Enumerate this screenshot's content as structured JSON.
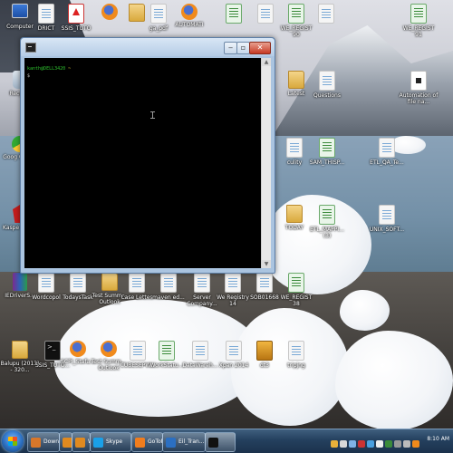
{
  "desktop": {
    "icons": [
      {
        "label": "Computer",
        "kind": "computer"
      },
      {
        "label": "Recycle",
        "kind": "recycle"
      },
      {
        "label": "Goog Chrom",
        "kind": "chrome"
      },
      {
        "label": "Kaspe Anti-V",
        "kind": "kaspersky"
      },
      {
        "label": "DRICT",
        "kind": "doc"
      },
      {
        "label": "SSIS_TUTO",
        "kind": "pdf"
      },
      {
        "label": "",
        "kind": "firefox"
      },
      {
        "label": "",
        "kind": "folder"
      },
      {
        "label": "ga_pdf",
        "kind": "doc"
      },
      {
        "label": "AUTOMATI",
        "kind": "firefox"
      },
      {
        "label": "",
        "kind": "xls"
      },
      {
        "label": "",
        "kind": "doc"
      },
      {
        "label": "WE_REGIST 90",
        "kind": "xls"
      },
      {
        "label": "",
        "kind": "doc"
      },
      {
        "label": "WE_REGIST 91",
        "kind": "xls"
      },
      {
        "label": "Latest",
        "kind": "folder"
      },
      {
        "label": "Questions",
        "kind": "doc"
      },
      {
        "label": "Automation of file na...",
        "kind": "auto"
      },
      {
        "label": "culity",
        "kind": "doc"
      },
      {
        "label": "SAM_THISP...",
        "kind": "xls"
      },
      {
        "label": "ETL_QA_Te...",
        "kind": "doc"
      },
      {
        "label": "TODAY",
        "kind": "folder"
      },
      {
        "label": "ETL_MAPPI... (3)",
        "kind": "xls"
      },
      {
        "label": "UNIX_SOFT...",
        "kind": "doc"
      },
      {
        "label": "IEDriverS...",
        "kind": "winrar"
      },
      {
        "label": "Wordcopol",
        "kind": "doc"
      },
      {
        "label": "TodaysTask",
        "kind": "doc"
      },
      {
        "label": "Test Summ... Outlook",
        "kind": "folder"
      },
      {
        "label": "Case Lettes",
        "kind": "doc"
      },
      {
        "label": "maven ed...",
        "kind": "doc"
      },
      {
        "label": "Server Company...",
        "kind": "doc"
      },
      {
        "label": "We Registry 14",
        "kind": "doc"
      },
      {
        "label": "SOB01668",
        "kind": "doc"
      },
      {
        "label": "WE_REGIST 38",
        "kind": "xls"
      },
      {
        "label": "Balupu (2013) - 320...",
        "kind": "folder"
      },
      {
        "label": "SSIS_TUTO...",
        "kind": "cmd"
      },
      {
        "label": "SCPI_Stafa...",
        "kind": "firefox"
      },
      {
        "label": "Test Summ... Outlook",
        "kind": "firefox"
      },
      {
        "label": "CUBESEPW...",
        "kind": "doc"
      },
      {
        "label": "WorkStatu...",
        "kind": "xls"
      },
      {
        "label": "DataWareh...",
        "kind": "doc"
      },
      {
        "label": "Xpan 2014",
        "kind": "doc"
      },
      {
        "label": "dt3",
        "kind": "gold"
      },
      {
        "label": "tripjng",
        "kind": "doc"
      }
    ]
  },
  "terminal": {
    "prompt_user": "kanth@DELL3420",
    "prompt_path": "~",
    "prompt_symbol": "$",
    "close_glyph": "✕",
    "max_glyph": "▫",
    "min_glyph": "‒"
  },
  "taskbar": {
    "buttons": [
      {
        "label": "Downlo...",
        "color": "#d8772a"
      },
      {
        "label": "",
        "color": "#e08a20"
      },
      {
        "label": "Web St...",
        "color": "#e08a20"
      },
      {
        "label": "Skype",
        "color": "#1aa0e8"
      },
      {
        "label": "GoToMe...",
        "color": "#f07d1e"
      },
      {
        "label": "Eil_Tran...",
        "color": "#2b6fc2"
      },
      {
        "label": "",
        "color": "#111111"
      }
    ],
    "clock": "8:10 AM"
  }
}
